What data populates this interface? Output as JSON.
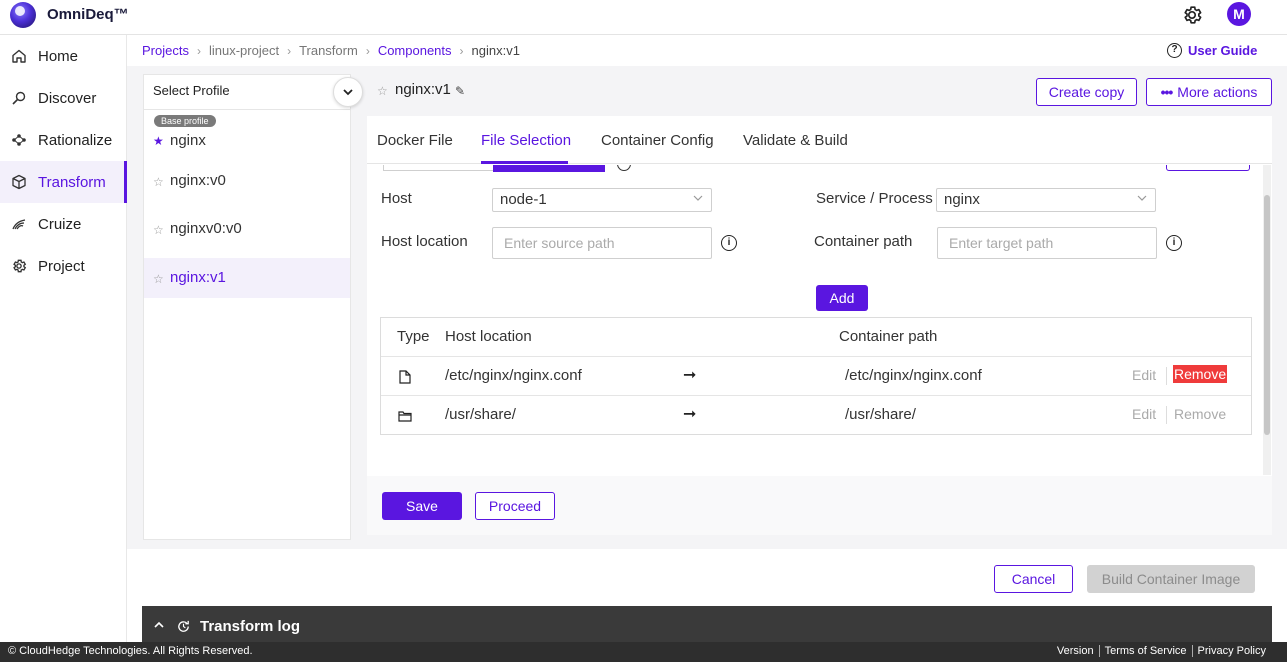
{
  "app": {
    "brand": "OmniDeq™",
    "avatar_initial": "M",
    "accent": "#5a16e0"
  },
  "sidebar": {
    "items": [
      {
        "label": "Home",
        "icon": "home-icon"
      },
      {
        "label": "Discover",
        "icon": "discover-icon"
      },
      {
        "label": "Rationalize",
        "icon": "rationalize-icon"
      },
      {
        "label": "Transform",
        "icon": "cube-icon",
        "active": true
      },
      {
        "label": "Cruize",
        "icon": "cruize-icon"
      },
      {
        "label": "Project",
        "icon": "gear-icon"
      }
    ]
  },
  "breadcrumb": [
    "Projects",
    "linux-project",
    "Transform",
    "Components",
    "nginx:v1"
  ],
  "user_guide": "User Guide",
  "profiles": {
    "header": "Select Profile",
    "base_badge": "Base profile",
    "items": [
      "nginx",
      "nginx:v0",
      "nginxv0:v0",
      "nginx:v1"
    ]
  },
  "component": {
    "title": "nginx:v1",
    "create_copy": "Create copy",
    "more_actions": "More actions"
  },
  "tabs": [
    "Docker File",
    "File Selection",
    "Container Config",
    "Validate & Build"
  ],
  "form": {
    "host_label": "Host",
    "host_value": "node-1",
    "service_label": "Service / Process",
    "service_value": "nginx",
    "host_location_label": "Host location",
    "host_location_placeholder": "Enter source path",
    "container_path_label": "Container path",
    "container_path_placeholder": "Enter target path",
    "add": "Add"
  },
  "table": {
    "headers": [
      "Type",
      "Host location",
      "Container path"
    ],
    "rows": [
      {
        "type": "file",
        "host": "/etc/nginx/nginx.conf",
        "container": "/etc/nginx/nginx.conf",
        "edit": "Edit",
        "remove": "Remove"
      },
      {
        "type": "folder",
        "host": "/usr/share/",
        "container": "/usr/share/",
        "edit": "Edit",
        "remove": "Remove"
      }
    ]
  },
  "actions": {
    "save": "Save",
    "proceed": "Proceed",
    "cancel": "Cancel",
    "build": "Build Container Image"
  },
  "log": {
    "title": "Transform log"
  },
  "footer": {
    "copyright": "© CloudHedge Technologies. All Rights Reserved.",
    "links": [
      "Version",
      "Terms of Service",
      "Privacy Policy"
    ]
  }
}
